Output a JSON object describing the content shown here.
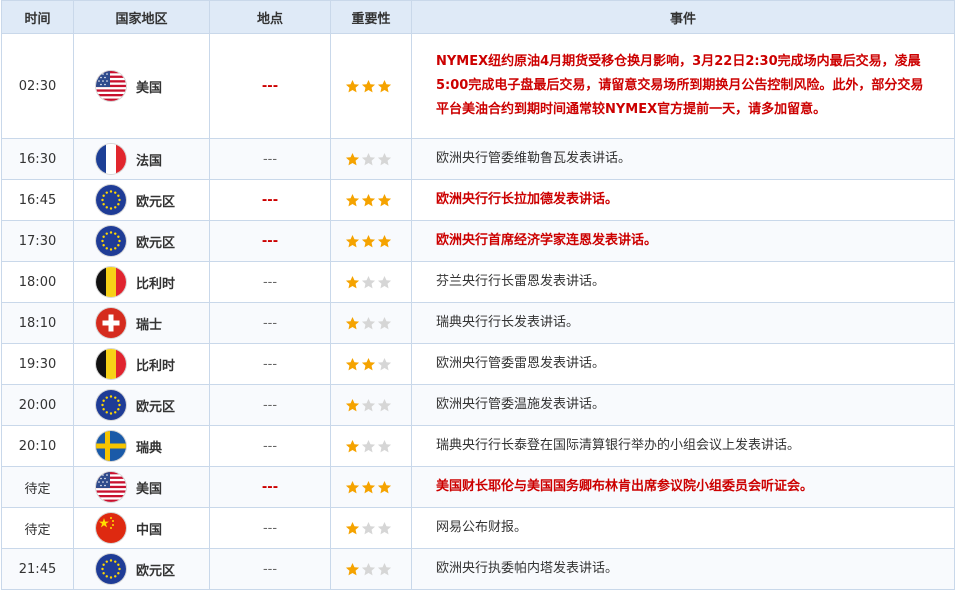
{
  "table": {
    "headers": [
      "时间",
      "国家地区",
      "地点",
      "重要性",
      "事件"
    ],
    "rows": [
      {
        "time": "02:30",
        "country": "美国",
        "flag": "us-flag-icon",
        "location": "---",
        "importance": 3,
        "highlight": true,
        "event": "NYMEX纽约原油4月期货受移仓换月影响，3月22日2:30完成场内最后交易，凌晨5:00完成电子盘最后交易，请留意交易场所到期换月公告控制风险。此外，部分交易平台美油合约到期时间通常较NYMEX官方提前一天，请多加留意。"
      },
      {
        "time": "16:30",
        "country": "法国",
        "flag": "france-flag-icon",
        "location": "---",
        "importance": 1,
        "highlight": false,
        "event": "欧洲央行管委维勒鲁瓦发表讲话。"
      },
      {
        "time": "16:45",
        "country": "欧元区",
        "flag": "eu-flag-icon",
        "location": "---",
        "importance": 3,
        "highlight": true,
        "event": "欧洲央行行长拉加德发表讲话。"
      },
      {
        "time": "17:30",
        "country": "欧元区",
        "flag": "eu-flag-icon",
        "location": "---",
        "importance": 3,
        "highlight": true,
        "event": "欧洲央行首席经济学家连恩发表讲话。"
      },
      {
        "time": "18:00",
        "country": "比利时",
        "flag": "belgium-flag-icon",
        "location": "---",
        "importance": 1,
        "highlight": false,
        "event": "芬兰央行行长雷恩发表讲话。"
      },
      {
        "time": "18:10",
        "country": "瑞士",
        "flag": "switzerland-flag-icon",
        "location": "---",
        "importance": 1,
        "highlight": false,
        "event": "瑞典央行行长发表讲话。"
      },
      {
        "time": "19:30",
        "country": "比利时",
        "flag": "belgium-flag-icon",
        "location": "---",
        "importance": 2,
        "highlight": false,
        "event": "欧洲央行管委雷恩发表讲话。"
      },
      {
        "time": "20:00",
        "country": "欧元区",
        "flag": "eu-flag-icon",
        "location": "---",
        "importance": 1,
        "highlight": false,
        "event": "欧洲央行管委温施发表讲话。"
      },
      {
        "time": "20:10",
        "country": "瑞典",
        "flag": "sweden-flag-icon",
        "location": "---",
        "importance": 1,
        "highlight": false,
        "event": "瑞典央行行长泰登在国际清算银行举办的小组会议上发表讲话。"
      },
      {
        "time": "待定",
        "country": "美国",
        "flag": "us-flag-icon",
        "location": "---",
        "importance": 3,
        "highlight": true,
        "event": "美国财长耶伦与美国国务卿布林肯出席参议院小组委员会听证会。"
      },
      {
        "time": "待定",
        "country": "中国",
        "flag": "china-flag-icon",
        "location": "---",
        "importance": 1,
        "highlight": false,
        "event": "网易公布财报。"
      },
      {
        "time": "21:45",
        "country": "欧元区",
        "flag": "eu-flag-icon",
        "location": "---",
        "importance": 1,
        "highlight": false,
        "event": "欧洲央行执委帕内塔发表讲话。"
      }
    ]
  },
  "colors": {
    "star_on": "#f5a300",
    "star_off": "#d6d6d6",
    "highlight_text": "#cc0000",
    "header_bg": "#dfeaf7",
    "border": "#c9d8ea"
  }
}
